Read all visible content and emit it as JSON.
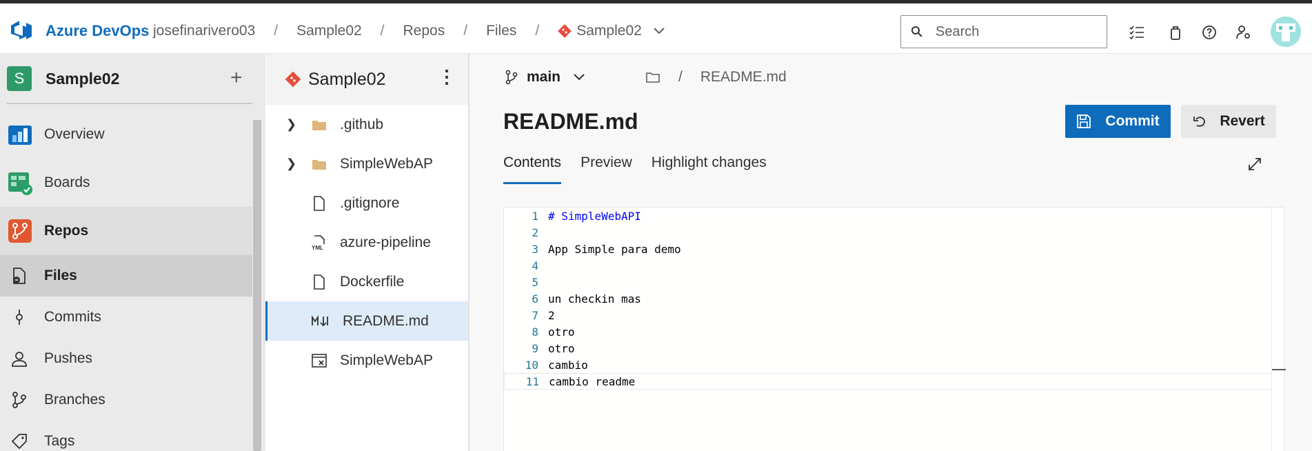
{
  "header": {
    "brand": "Azure DevOps",
    "breadcrumbs": [
      "josefinarivero03",
      "Sample02",
      "Repos",
      "Files"
    ],
    "repo_selector": "Sample02",
    "separator": "/",
    "search_placeholder": "Search"
  },
  "left_nav": {
    "project_initial": "S",
    "project_name": "Sample02",
    "items": [
      {
        "label": "Overview",
        "icon": "overview-icon"
      },
      {
        "label": "Boards",
        "icon": "boards-icon"
      },
      {
        "label": "Repos",
        "icon": "repos-icon"
      },
      {
        "label": "Files",
        "icon": "files-icon"
      },
      {
        "label": "Commits",
        "icon": "commits-icon"
      },
      {
        "label": "Pushes",
        "icon": "pushes-icon"
      },
      {
        "label": "Branches",
        "icon": "branches-icon"
      },
      {
        "label": "Tags",
        "icon": "tags-icon"
      }
    ]
  },
  "file_tree": {
    "repo_name": "Sample02",
    "items": [
      {
        "label": ".github",
        "type": "folder"
      },
      {
        "label": "SimpleWebAP",
        "type": "folder"
      },
      {
        "label": ".gitignore",
        "type": "file"
      },
      {
        "label": "azure-pipeline",
        "type": "yml"
      },
      {
        "label": "Dockerfile",
        "type": "file"
      },
      {
        "label": "README.md",
        "type": "markdown"
      },
      {
        "label": "SimpleWebAP",
        "type": "solution"
      }
    ]
  },
  "main": {
    "branch": "main",
    "path_sep": "/",
    "path_file": "README.md",
    "title": "README.md",
    "commit_label": "Commit",
    "revert_label": "Revert",
    "tabs": [
      "Contents",
      "Preview",
      "Highlight changes"
    ],
    "active_tab": "Contents"
  },
  "editor": {
    "lines": [
      {
        "n": "1",
        "text": "# SimpleWebAPI"
      },
      {
        "n": "2",
        "text": ""
      },
      {
        "n": "3",
        "text": "App Simple para demo"
      },
      {
        "n": "4",
        "text": ""
      },
      {
        "n": "5",
        "text": ""
      },
      {
        "n": "6",
        "text": "un checkin mas"
      },
      {
        "n": "7",
        "text": "2"
      },
      {
        "n": "8",
        "text": "otro"
      },
      {
        "n": "9",
        "text": "otro"
      },
      {
        "n": "10",
        "text": "cambio"
      },
      {
        "n": "11",
        "text": "cambio readme"
      }
    ]
  },
  "colors": {
    "accent": "#0f6cbd",
    "project_badge": "#2e9a6a",
    "repo_icon": "#e74c3c",
    "selected_row": "#deecf9"
  }
}
